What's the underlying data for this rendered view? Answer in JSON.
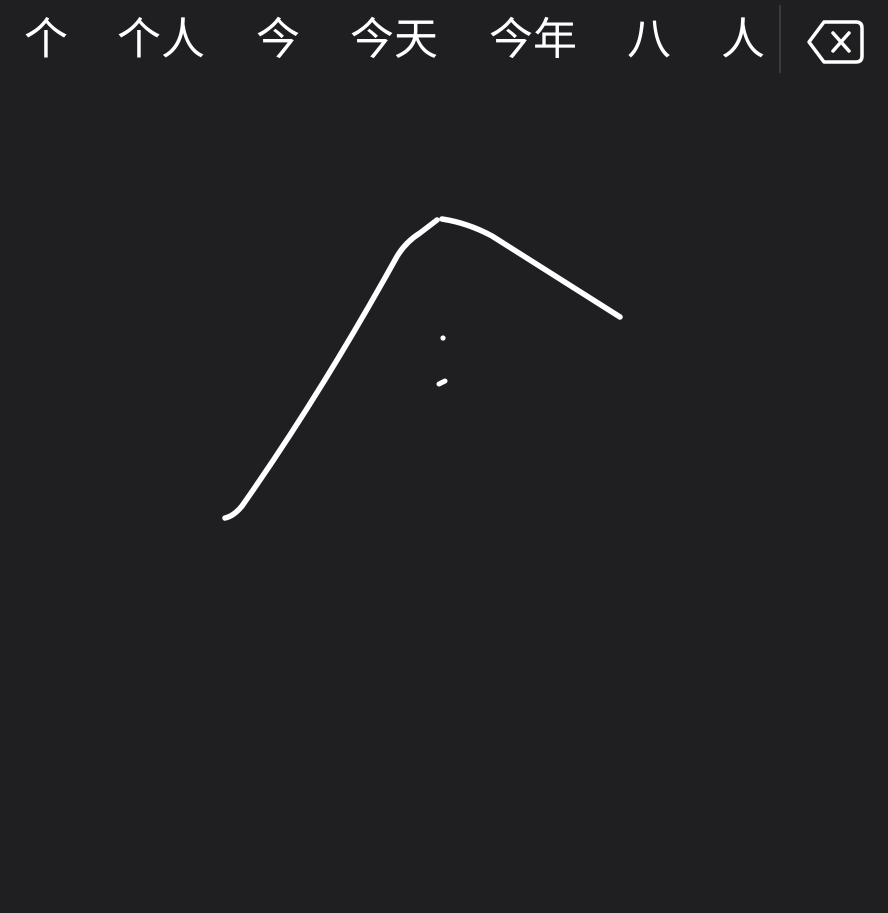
{
  "candidates": [
    {
      "label": "个"
    },
    {
      "label": "个人"
    },
    {
      "label": "今"
    },
    {
      "label": "今天"
    },
    {
      "label": "今年"
    },
    {
      "label": "八"
    },
    {
      "label": "人"
    }
  ],
  "delete_key": {
    "icon": "delete-backward-icon"
  },
  "handwriting_area": {
    "stroke_color": "#ffffff",
    "background_color": "#1f1e21"
  }
}
